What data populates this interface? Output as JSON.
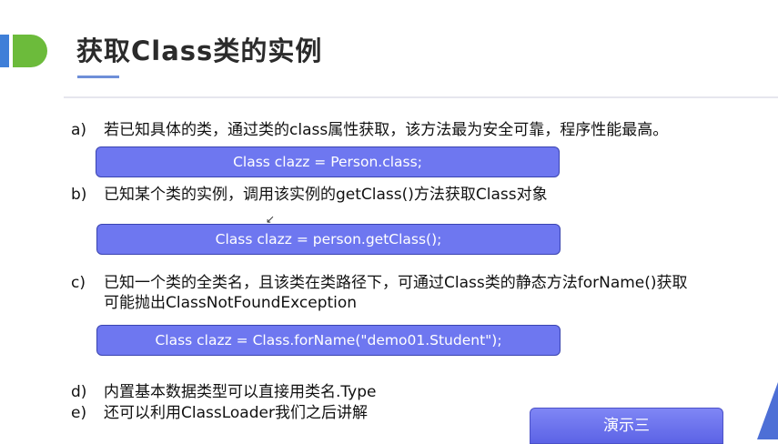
{
  "slide": {
    "title": "获取Class类的实例",
    "items": [
      {
        "letter": "a)",
        "text": "若已知具体的类，通过类的class属性获取，该方法最为安全可靠，程序性能最高。",
        "code": "Class clazz = Person.class;"
      },
      {
        "letter": "b)",
        "text": "已知某个类的实例，调用该实例的getClass()方法获取Class对象",
        "code": "Class clazz = person.getClass();"
      },
      {
        "letter": "c)",
        "text": "已知一个类的全类名，且该类在类路径下，可通过Class类的静态方法forName()获取",
        "text2": "可能抛出ClassNotFoundException",
        "code": "Class clazz = Class.forName(\"demo01.Student\");"
      },
      {
        "letter": "d)",
        "text": "内置基本数据类型可以直接用类名.Type"
      },
      {
        "letter": "e)",
        "text": "还可以利用ClassLoader我们之后讲解"
      }
    ],
    "demo_button": "演示三",
    "cursor_glyph": "↙"
  },
  "colors": {
    "accent_blue": "#3f7fd8",
    "accent_green": "#6cbb3b",
    "code_box": "#6e77f0",
    "button": "#6a71ee"
  }
}
